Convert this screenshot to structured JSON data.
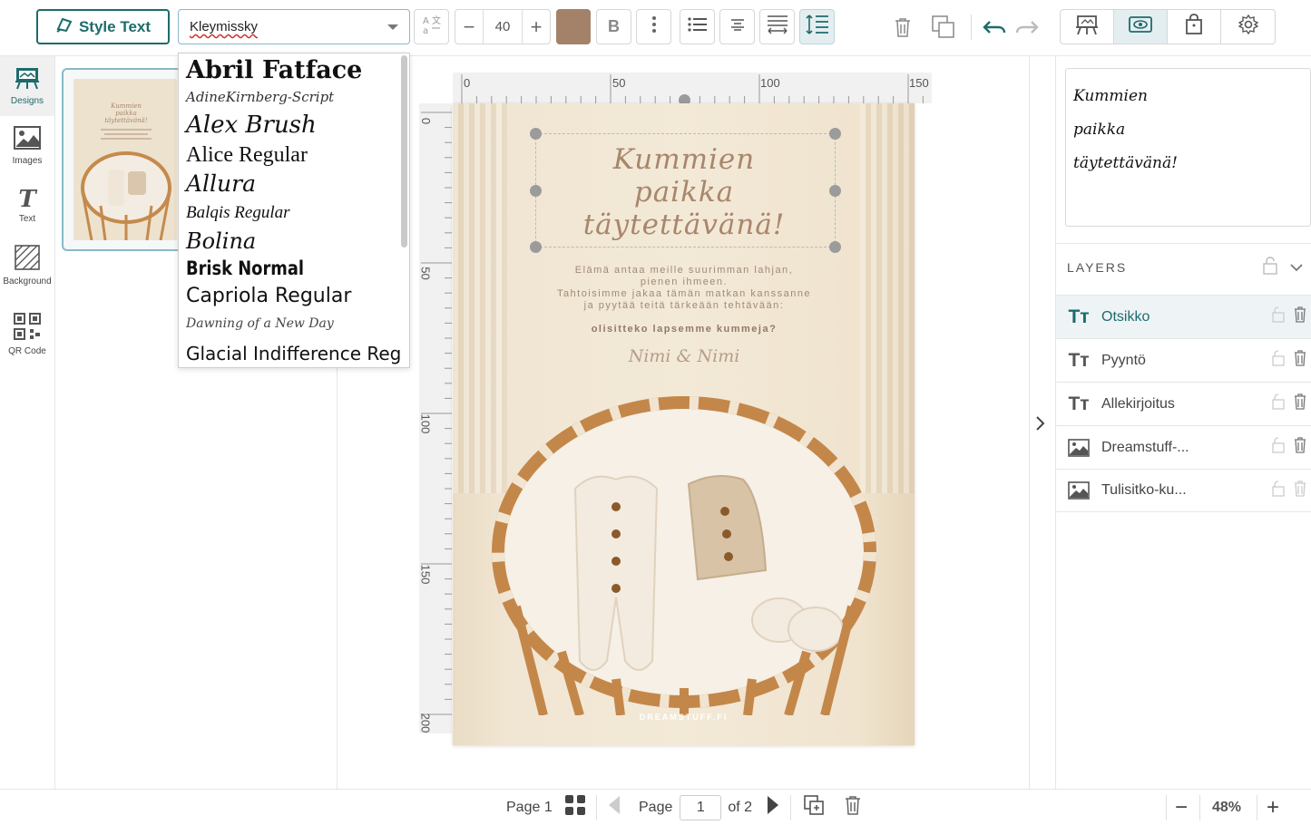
{
  "toolbar": {
    "style_text_label": "Style Text",
    "font_value": "Kleymissky",
    "font_size": "40",
    "minus_label": "−",
    "plus_label": "+",
    "bold_label": "B",
    "text_color": "#a38269"
  },
  "font_dropdown": {
    "items": [
      "Abril Fatface",
      "AdineKirnberg-Script",
      "Alex Brush",
      "Alice Regular",
      "Allura",
      "Balqis Regular",
      "Bolina",
      "Brisk Normal",
      "Capriola Regular",
      "Dawning of a New Day",
      "Glacial Indifference Reg"
    ]
  },
  "rail": {
    "designs": "Designs",
    "images": "Images",
    "text": "Text",
    "background": "Background",
    "qr": "QR Code"
  },
  "rulers": {
    "h": [
      "0",
      "50",
      "100",
      "150"
    ],
    "v": [
      "0",
      "50",
      "100",
      "150",
      "200"
    ]
  },
  "card": {
    "title_lines": [
      "Kummien",
      "paikka",
      "täytettävänä!"
    ],
    "body_lines": [
      "Elämä antaa meille suurimman lahjan,",
      "pienen ihmeen.",
      "Tahtoisimme jakaa tämän matkan kanssanne",
      "ja pyytää teitä tärkeään tehtävään:"
    ],
    "question": "olisitteko lapsemme kummeja?",
    "signature": "Nimi & Nimi",
    "brand": "DREAMSTUFF.FI"
  },
  "preview": {
    "lines": [
      "Kummien",
      "paikka",
      "täytettävänä!"
    ]
  },
  "layers": {
    "heading": "LAYERS",
    "items": [
      {
        "name": "Otsikko",
        "type": "text"
      },
      {
        "name": "Pyyntö",
        "type": "text"
      },
      {
        "name": "Allekirjoitus",
        "type": "text"
      },
      {
        "name": "Dreamstuff-...",
        "type": "image"
      },
      {
        "name": "Tulisitko-ku...",
        "type": "image"
      }
    ]
  },
  "bottom": {
    "page_label": "Page 1",
    "page_word": "Page",
    "page_number": "1",
    "of_total": "of 2",
    "zoom": "48%",
    "zoom_minus": "−",
    "zoom_plus": "+"
  },
  "colors": {
    "accent": "#1d6b6b",
    "title_text": "#a8866c"
  }
}
